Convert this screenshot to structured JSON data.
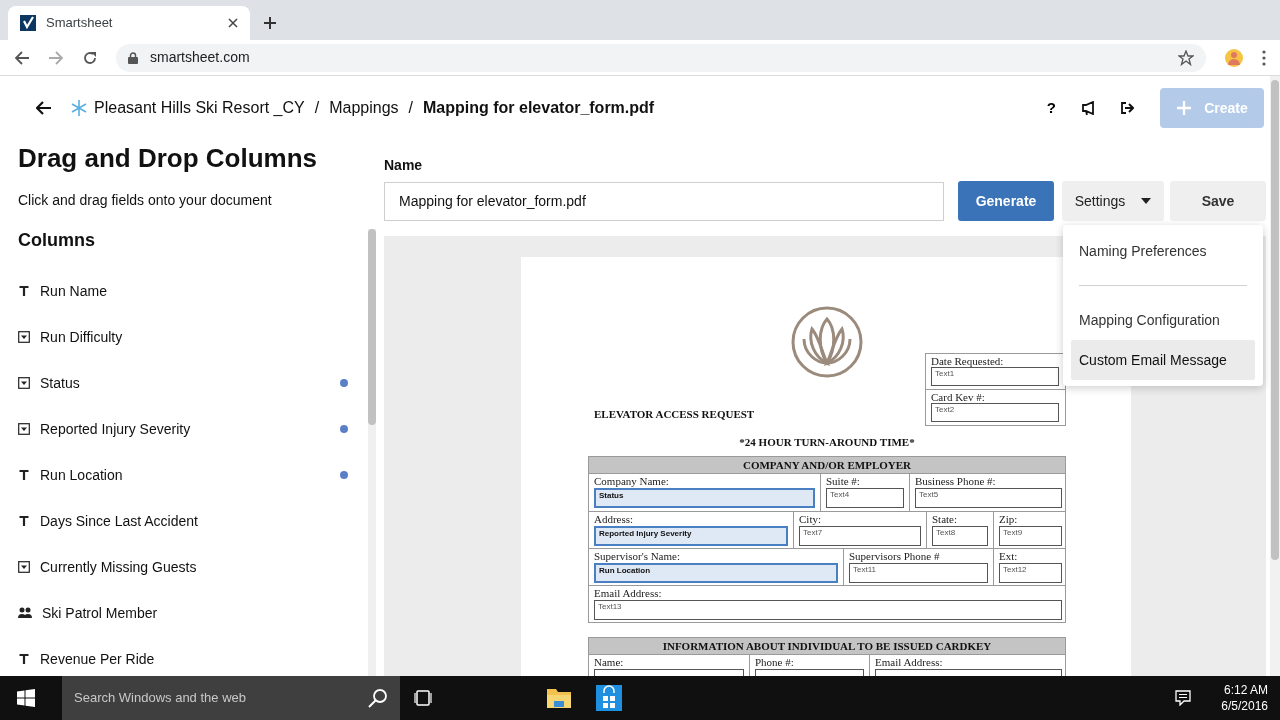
{
  "browser": {
    "tab_title": "Smartsheet",
    "url": "smartsheet.com"
  },
  "breadcrumb": [
    {
      "label": "Pleasant Hills Ski Resort _CY",
      "current": false,
      "separator": "/"
    },
    {
      "label": "Mappings",
      "current": false,
      "separator": "/"
    },
    {
      "label": "Mapping for elevator_form.pdf",
      "current": true
    }
  ],
  "header": {
    "help": "?",
    "create_button": "Create",
    "create_disabled": true
  },
  "sidebar": {
    "title": "Drag and Drop Columns",
    "subtitle": "Click and drag fields onto your document",
    "columns_heading": "Columns",
    "columns": [
      {
        "name": "Run Name",
        "kind": "text",
        "mapped": false
      },
      {
        "name": "Run Difficulty",
        "kind": "dropdown",
        "mapped": false
      },
      {
        "name": "Status",
        "kind": "dropdown",
        "mapped": true
      },
      {
        "name": "Reported Injury Severity",
        "kind": "dropdown",
        "mapped": true
      },
      {
        "name": "Run Location",
        "kind": "text",
        "mapped": true
      },
      {
        "name": "Days Since Last Accident",
        "kind": "text",
        "mapped": false
      },
      {
        "name": "Currently Missing Guests",
        "kind": "dropdown",
        "mapped": false
      },
      {
        "name": "Ski Patrol Member",
        "kind": "contact",
        "mapped": false
      },
      {
        "name": "Revenue Per Ride",
        "kind": "text",
        "mapped": false
      }
    ]
  },
  "name_field": {
    "label": "Name",
    "value": "Mapping for elevator_form.pdf"
  },
  "buttons": {
    "generate": "Generate",
    "settings": "Settings",
    "save": "Save"
  },
  "settings_menu": {
    "sections": [
      [
        {
          "label": "Naming Preferences",
          "selected": false
        }
      ],
      [
        {
          "label": "Mapping Configuration",
          "selected": false
        },
        {
          "label": "Custom Email Message",
          "selected": true
        }
      ]
    ]
  },
  "document": {
    "header_fields": [
      {
        "label": "Date Requested:",
        "field": "Text1"
      },
      {
        "label": "Card Kev #:",
        "field": "Text2"
      }
    ],
    "title": "ELEVATOR ACCESS REQUEST",
    "subtitle": "*24 HOUR TURN-AROUND TIME*",
    "sections": [
      {
        "heading": "COMPANY AND/OR EMPLOYER",
        "lines": [
          {
            "fields": [
              {
                "label": "Company Name:",
                "field": "Status",
                "mapped": true
              },
              {
                "label": "Suite #:",
                "field": "Text4",
                "mapped": false
              },
              {
                "label": "Business Phone #:",
                "field": "Text5",
                "mapped": false
              }
            ]
          },
          {
            "fields": [
              {
                "label": "Address:",
                "field": "Reported Injury Severity",
                "mapped": true
              },
              {
                "label": "City:",
                "field": "Text7",
                "mapped": false
              },
              {
                "label": "State:",
                "field": "Text8",
                "mapped": false
              },
              {
                "label": "Zip:",
                "field": "Text9",
                "mapped": false
              }
            ]
          },
          {
            "fields": [
              {
                "label": "Supervisor's Name:",
                "field": "Run Location",
                "mapped": true
              },
              {
                "label": "Supervisors Phone #",
                "field": "Text11",
                "mapped": false
              },
              {
                "label": "Ext:",
                "field": "Text12",
                "mapped": false
              }
            ]
          },
          {
            "fields": [
              {
                "label": "Email Address:",
                "field": "Text13",
                "mapped": false
              }
            ]
          }
        ]
      },
      {
        "heading": "INFORMATION ABOUT INDIVIDUAL TO BE ISSUED CARDKEY",
        "lines": [
          {
            "fields": [
              {
                "label": "Name:",
                "mapped": false
              },
              {
                "label": "Phone #:",
                "mapped": false
              },
              {
                "label": "Email Address:",
                "mapped": false
              }
            ]
          }
        ]
      }
    ]
  },
  "taskbar": {
    "search_placeholder": "Search Windows and the web",
    "time": "6:12 AM",
    "date": "6/5/2016"
  }
}
